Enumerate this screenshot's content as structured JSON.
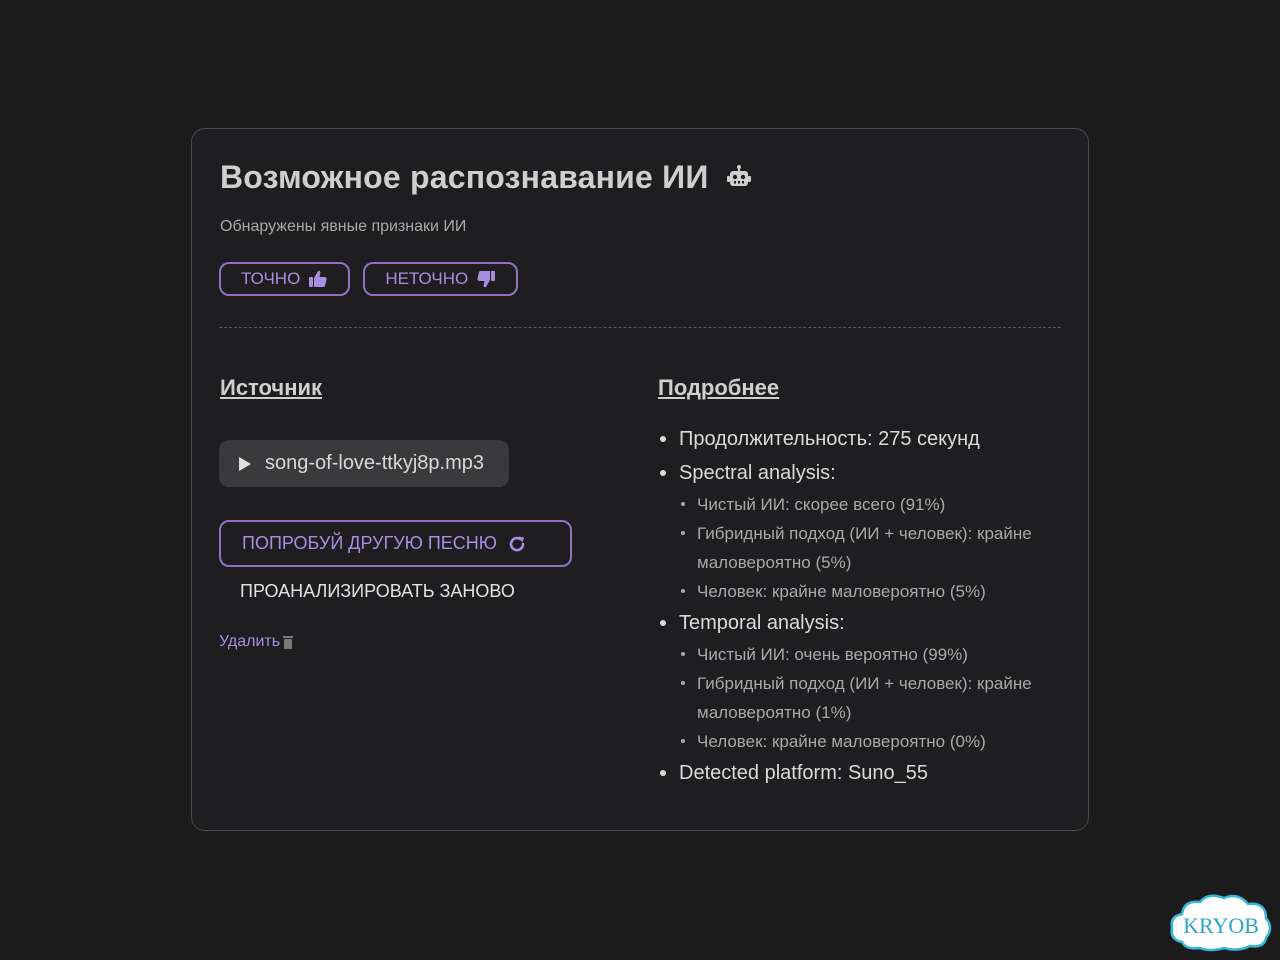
{
  "card": {
    "title": "Возможное распознавание ИИ",
    "title_icon": "robot-icon",
    "subtitle": "Обнаружены явные признаки ИИ",
    "feedback": {
      "accurate_label": "ТОЧНО",
      "accurate_icon": "thumbs-up-icon",
      "inaccurate_label": "НЕТОЧНО",
      "inaccurate_icon": "thumbs-down-icon"
    }
  },
  "source": {
    "heading": "Источник",
    "file_name": "song-of-love-ttkyj8p.mp3",
    "try_another_label": "ПОПРОБУЙ ДРУГУЮ ПЕСНЮ",
    "reanalyze_label": "ПРОАНАЛИЗИРОВАТЬ ЗАНОВО",
    "delete_label": "Удалить"
  },
  "details": {
    "heading": "Подробнее",
    "duration": "Продолжительность: 275 секунд",
    "spectral": {
      "label": "Spectral analysis:",
      "items": [
        "Чистый ИИ: скорее всего (91%)",
        "Гибридный подход (ИИ + человек): крайне маловероятно (5%)",
        "Человек: крайне маловероятно (5%)"
      ]
    },
    "temporal": {
      "label": "Temporal analysis:",
      "items": [
        "Чистый ИИ: очень вероятно (99%)",
        "Гибридный подход (ИИ + человек): крайне маловероятно (1%)",
        "Человек: крайне маловероятно (0%)"
      ]
    },
    "platform": "Detected platform: Suno_55"
  },
  "watermark": {
    "text": "KRYOB"
  },
  "colors": {
    "accent": "#a98de0",
    "background": "#1b1b1c",
    "card_border": "#4a4a4d"
  }
}
